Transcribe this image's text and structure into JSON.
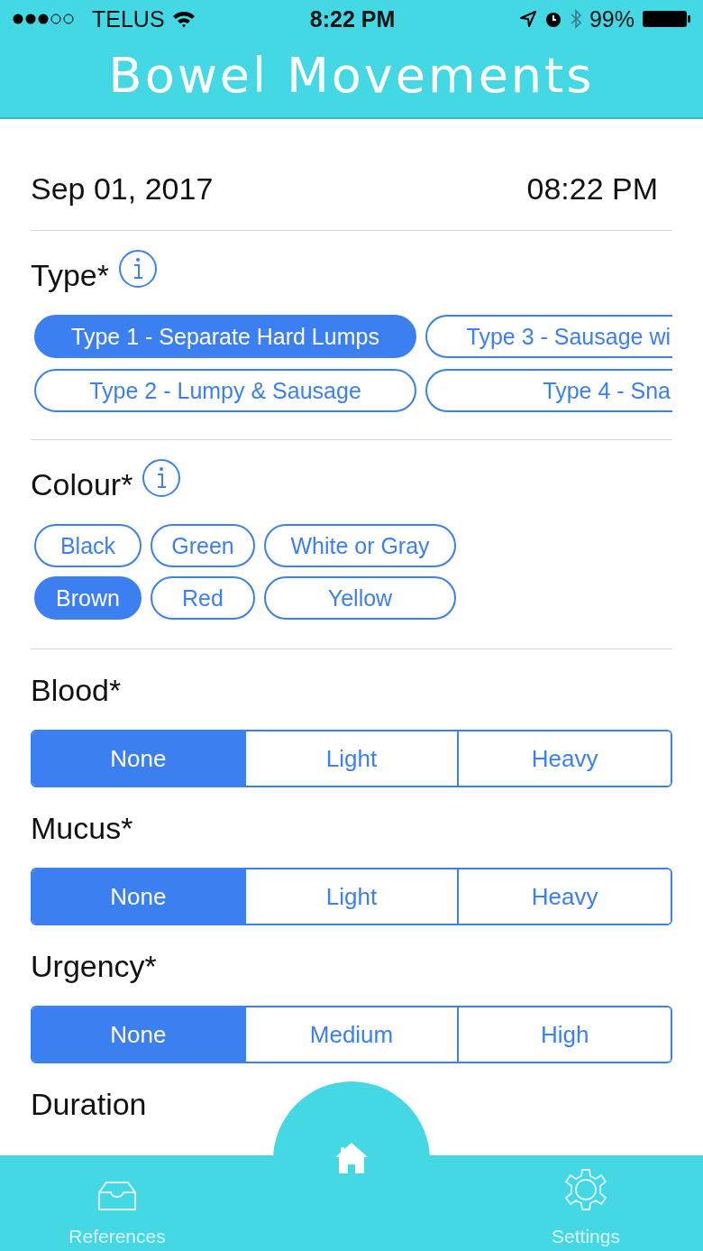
{
  "status_bar": {
    "carrier": "TELUS",
    "time": "8:22 PM",
    "battery": "99%"
  },
  "header": {
    "title": "Bowel Movements"
  },
  "entry": {
    "date": "Sep 01, 2017",
    "time": "08:22 PM"
  },
  "type": {
    "label": "Type*",
    "options": [
      {
        "label": "Type 1 - Separate Hard Lumps",
        "selected": true
      },
      {
        "label": "Type 3 - Sausage wi",
        "selected": false
      },
      {
        "label": "Type 2 - Lumpy & Sausage",
        "selected": false
      },
      {
        "label": "Type 4 - Sna",
        "selected": false
      }
    ]
  },
  "colour": {
    "label": "Colour*",
    "options": [
      {
        "label": "Black",
        "selected": false
      },
      {
        "label": "Green",
        "selected": false
      },
      {
        "label": "White or Gray",
        "selected": false
      },
      {
        "label": "Brown",
        "selected": true
      },
      {
        "label": "Red",
        "selected": false
      },
      {
        "label": "Yellow",
        "selected": false
      }
    ]
  },
  "segments": [
    {
      "label": "Blood*",
      "options": [
        {
          "label": "None",
          "selected": true
        },
        {
          "label": "Light",
          "selected": false
        },
        {
          "label": "Heavy",
          "selected": false
        }
      ]
    },
    {
      "label": "Mucus*",
      "options": [
        {
          "label": "None",
          "selected": true
        },
        {
          "label": "Light",
          "selected": false
        },
        {
          "label": "Heavy",
          "selected": false
        }
      ]
    },
    {
      "label": "Urgency*",
      "options": [
        {
          "label": "None",
          "selected": true
        },
        {
          "label": "Medium",
          "selected": false
        },
        {
          "label": "High",
          "selected": false
        }
      ]
    }
  ],
  "next_label": "Duration",
  "tab_bar": [
    {
      "kind": "references",
      "label": "References"
    },
    {
      "kind": "home"
    },
    {
      "kind": "settings",
      "label": "Settings"
    }
  ]
}
